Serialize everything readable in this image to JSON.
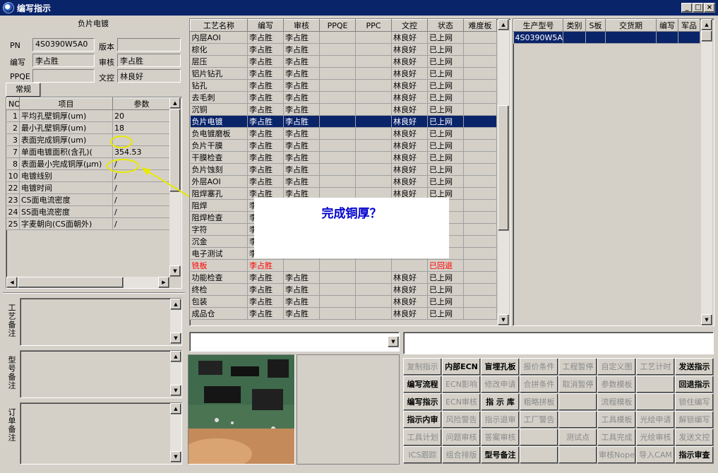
{
  "window": {
    "title": "编写指示",
    "min": "_",
    "max": "□",
    "close": "×"
  },
  "left": {
    "header": "负片电镀",
    "pn_label": "PN",
    "pn_value": "4S0390W5A0",
    "version_label": "版本",
    "version_value": "",
    "writer_label": "编写",
    "writer_value": "李占胜",
    "reviewer_label": "审核",
    "reviewer_value": "李占胜",
    "ppqe_label": "PPQE",
    "ppqe_value": "",
    "doc_label": "文控",
    "doc_value": "林良好",
    "tab": "常规",
    "param_headers": [
      "NO",
      "项目",
      "参数"
    ],
    "params": [
      {
        "no": "1",
        "item": "平均孔壁铜厚(um)",
        "value": "20"
      },
      {
        "no": "2",
        "item": "最小孔壁铜厚(um)",
        "value": "18"
      },
      {
        "no": "3",
        "item": "表面完成铜厚(um)",
        "value": ""
      },
      {
        "no": "7",
        "item": "单面电镀面积(含孔)(",
        "value": "354.53"
      },
      {
        "no": "8",
        "item": "表面最小完成铜厚(μm)",
        "value": "/"
      },
      {
        "no": "10",
        "item": "电镀线别",
        "value": "/"
      },
      {
        "no": "22",
        "item": "电镀时间",
        "value": "/"
      },
      {
        "no": "23",
        "item": "CS面电流密度",
        "value": "/"
      },
      {
        "no": "24",
        "item": "SS面电流密度",
        "value": "/"
      },
      {
        "no": "25",
        "item": "字麦朝向(CS面朝外)",
        "value": "/"
      }
    ],
    "notes": [
      {
        "label": "工艺备注"
      },
      {
        "label": "型号备注"
      },
      {
        "label": "订单备注"
      }
    ]
  },
  "process": {
    "headers": [
      "工艺名称",
      "编写",
      "审核",
      "PPQE",
      "PPC",
      "文控",
      "状态",
      "难度板"
    ],
    "rows": [
      [
        "内层AOI",
        "李占胜",
        "李占胜",
        "",
        "",
        "林良好",
        "已上网",
        ""
      ],
      [
        "棕化",
        "李占胜",
        "李占胜",
        "",
        "",
        "林良好",
        "已上网",
        ""
      ],
      [
        "层压",
        "李占胜",
        "李占胜",
        "",
        "",
        "林良好",
        "已上网",
        ""
      ],
      [
        "铝片钻孔",
        "李占胜",
        "李占胜",
        "",
        "",
        "林良好",
        "已上网",
        ""
      ],
      [
        "钻孔",
        "李占胜",
        "李占胜",
        "",
        "",
        "林良好",
        "已上网",
        ""
      ],
      [
        "去毛刺",
        "李占胜",
        "李占胜",
        "",
        "",
        "林良好",
        "已上网",
        ""
      ],
      [
        "沉铜",
        "李占胜",
        "李占胜",
        "",
        "",
        "林良好",
        "已上网",
        ""
      ],
      [
        "负片电镀",
        "李占胜",
        "李占胜",
        "",
        "",
        "林良好",
        "已上网",
        ""
      ],
      [
        "负电镀磨板",
        "李占胜",
        "李占胜",
        "",
        "",
        "林良好",
        "已上网",
        ""
      ],
      [
        "负片干膜",
        "李占胜",
        "李占胜",
        "",
        "",
        "林良好",
        "已上网",
        ""
      ],
      [
        "干膜检查",
        "李占胜",
        "李占胜",
        "",
        "",
        "林良好",
        "已上网",
        ""
      ],
      [
        "负片蚀刻",
        "李占胜",
        "李占胜",
        "",
        "",
        "林良好",
        "已上网",
        ""
      ],
      [
        "外层AOI",
        "李占胜",
        "李占胜",
        "",
        "",
        "林良好",
        "已上网",
        ""
      ],
      [
        "阻焊塞孔",
        "李占胜",
        "李占胜",
        "",
        "",
        "林良好",
        "已上网",
        ""
      ],
      [
        "阻焊",
        "李",
        "",
        "",
        "",
        "",
        "网",
        ""
      ],
      [
        "阻焊检查",
        "李",
        "",
        "",
        "",
        "",
        "网",
        ""
      ],
      [
        "字符",
        "李",
        "",
        "",
        "",
        "",
        "网",
        ""
      ],
      [
        "沉金",
        "李",
        "",
        "",
        "",
        "",
        "网",
        ""
      ],
      [
        "电子测试",
        "李",
        "",
        "",
        "",
        "",
        "网",
        ""
      ],
      [
        "铣板",
        "李占胜",
        "",
        "",
        "",
        "",
        "已回退",
        ""
      ],
      [
        "功能检查",
        "李占胜",
        "李占胜",
        "",
        "",
        "林良好",
        "已上网",
        ""
      ],
      [
        "终检",
        "李占胜",
        "李占胜",
        "",
        "",
        "林良好",
        "已上网",
        ""
      ],
      [
        "包装",
        "李占胜",
        "李占胜",
        "",
        "",
        "林良好",
        "已上网",
        ""
      ],
      [
        "成品仓",
        "李占胜",
        "李占胜",
        "",
        "",
        "林良好",
        "已上网",
        ""
      ]
    ],
    "selected_index": 7,
    "returned_index": 19
  },
  "overlay": {
    "text": "完成铜厚？"
  },
  "orders": {
    "headers": [
      "生产型号",
      "类别",
      "S板",
      "交货期",
      "编写",
      "军品"
    ],
    "rows": [
      [
        "4S0390W5A0",
        "",
        "",
        "",
        "",
        ""
      ]
    ]
  },
  "buttons": [
    {
      "label": "复制指示",
      "on": false
    },
    {
      "label": "内部ECN",
      "on": true
    },
    {
      "label": "盲埋孔板",
      "on": true
    },
    {
      "label": "报价条件",
      "on": false
    },
    {
      "label": "工程暂停",
      "on": false
    },
    {
      "label": "自定义图",
      "on": false
    },
    {
      "label": "工艺计时",
      "on": false
    },
    {
      "label": "发送指示",
      "on": true
    },
    {
      "label": "编写流程",
      "on": true
    },
    {
      "label": "ECN影响",
      "on": false
    },
    {
      "label": "修改申请",
      "on": false
    },
    {
      "label": "合拼条件",
      "on": false
    },
    {
      "label": "取消暂停",
      "on": false
    },
    {
      "label": "参数模板",
      "on": false
    },
    {
      "label": "",
      "on": false
    },
    {
      "label": "回退指示",
      "on": true
    },
    {
      "label": "编写指示",
      "on": true
    },
    {
      "label": "ECN审核",
      "on": false
    },
    {
      "label": "指 示 库",
      "on": true
    },
    {
      "label": "粗略拼板",
      "on": false
    },
    {
      "label": "",
      "on": false
    },
    {
      "label": "流程模板",
      "on": false
    },
    {
      "label": "",
      "on": false
    },
    {
      "label": "锁住编写",
      "on": false
    },
    {
      "label": "指示内审",
      "on": true
    },
    {
      "label": "风险警告",
      "on": false
    },
    {
      "label": "指示退审",
      "on": false
    },
    {
      "label": "工厂警告",
      "on": false
    },
    {
      "label": "",
      "on": false
    },
    {
      "label": "工具模板",
      "on": false
    },
    {
      "label": "光绘申请",
      "on": false
    },
    {
      "label": "解锁编写",
      "on": false
    },
    {
      "label": "工具计划",
      "on": false
    },
    {
      "label": "问题审核",
      "on": false
    },
    {
      "label": "答案审核",
      "on": false
    },
    {
      "label": "",
      "on": false
    },
    {
      "label": "测试点",
      "on": false
    },
    {
      "label": "工具完成",
      "on": false
    },
    {
      "label": "光绘审核",
      "on": false
    },
    {
      "label": "发送文控",
      "on": false
    },
    {
      "label": "ICS跟踪",
      "on": false
    },
    {
      "label": "组合排版",
      "on": false
    },
    {
      "label": "型号备注",
      "on": true
    },
    {
      "label": "",
      "on": false
    },
    {
      "label": "",
      "on": false
    },
    {
      "label": "审核Nope",
      "on": false
    },
    {
      "label": "导入CAM",
      "on": false
    },
    {
      "label": "指示审查",
      "on": true
    }
  ],
  "colors": {
    "selection": "#0a246a",
    "title_bar": "#0a246a",
    "highlight": "#e8e800",
    "overlay_text": "#0000cc",
    "returned": "#ff0000"
  }
}
